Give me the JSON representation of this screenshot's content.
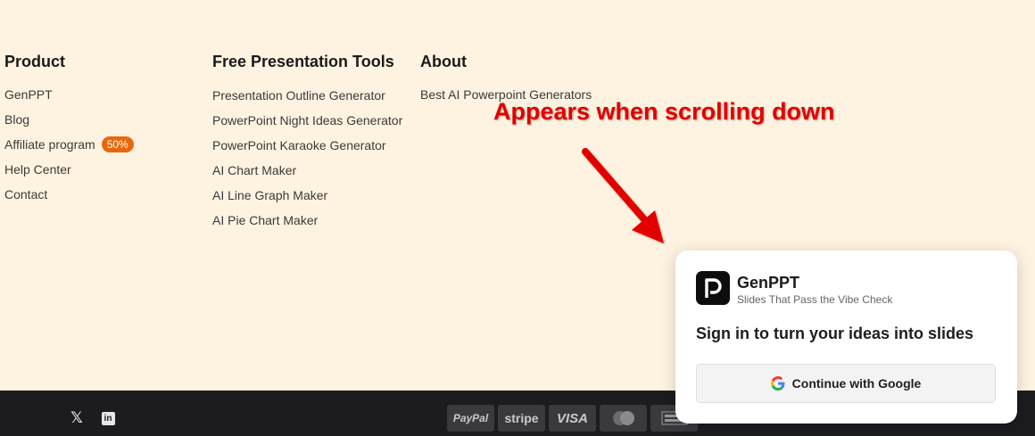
{
  "product": {
    "heading": "Product",
    "items": [
      "GenPPT",
      "Blog",
      "Affiliate program",
      "Help Center",
      "Contact"
    ],
    "affiliate_badge": "50%"
  },
  "tools": {
    "heading": "Free Presentation Tools",
    "items": [
      "Presentation Outline Generator",
      "PowerPoint Night Ideas Generator",
      "PowerPoint Karaoke Generator",
      "AI Chart Maker",
      "AI Line Graph Maker",
      "AI Pie Chart Maker"
    ]
  },
  "about": {
    "heading": "About",
    "items": [
      "Best AI Powerpoint Generators"
    ]
  },
  "annotation": {
    "text": "Appears when scrolling down",
    "color": "#e10000"
  },
  "social": {
    "x_icon": "x-logo-icon",
    "linkedin_icon": "linkedin-icon"
  },
  "payments": [
    "PayPal",
    "stripe",
    "VISA",
    "mastercard-icon",
    "amex-icon"
  ],
  "popup": {
    "brand": "GenPPT",
    "tagline": "Slides That Pass the Vibe Check",
    "heading": "Sign in to turn your ideas into slides",
    "button_label": "Continue with Google",
    "logo_letter": "P"
  },
  "colors": {
    "background": "#fef3e0",
    "badge": "#e8680c",
    "bottom_bar": "#1c1b1f"
  }
}
